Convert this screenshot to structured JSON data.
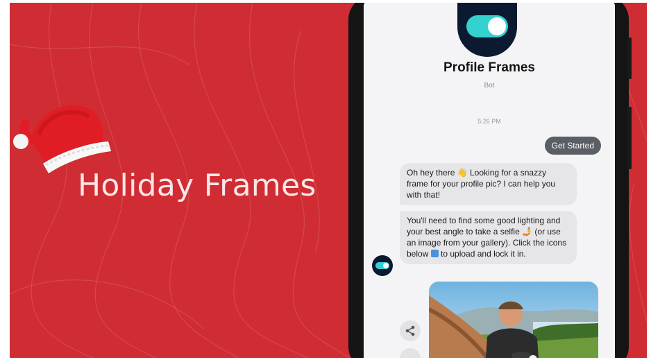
{
  "banner": {
    "title": "Holiday Frames",
    "icon": "santa-hat-icon",
    "background_color": "#d02c33"
  },
  "bot": {
    "name": "Profile Frames",
    "type": "Bot",
    "avatar_icon": "toggle-switch-icon"
  },
  "chat": {
    "timestamp": "5:26 PM",
    "user_message": "Get Started",
    "bot_message_1": {
      "before_emoji": "Oh hey there ",
      "emoji": "👋",
      "after_emoji": " Looking for a snazzy frame for your profile pic? I can help you with that!"
    },
    "bot_message_2": {
      "part_1": "You'll need to find some good lighting and your best angle to take a selfie ",
      "emoji": "🤳",
      "part_2": " (or use an image from your gallery). Click the icons below ",
      "part_3": " to upload and lock it in."
    },
    "share_icon": "share-icon",
    "photo": "selfie-photo"
  }
}
